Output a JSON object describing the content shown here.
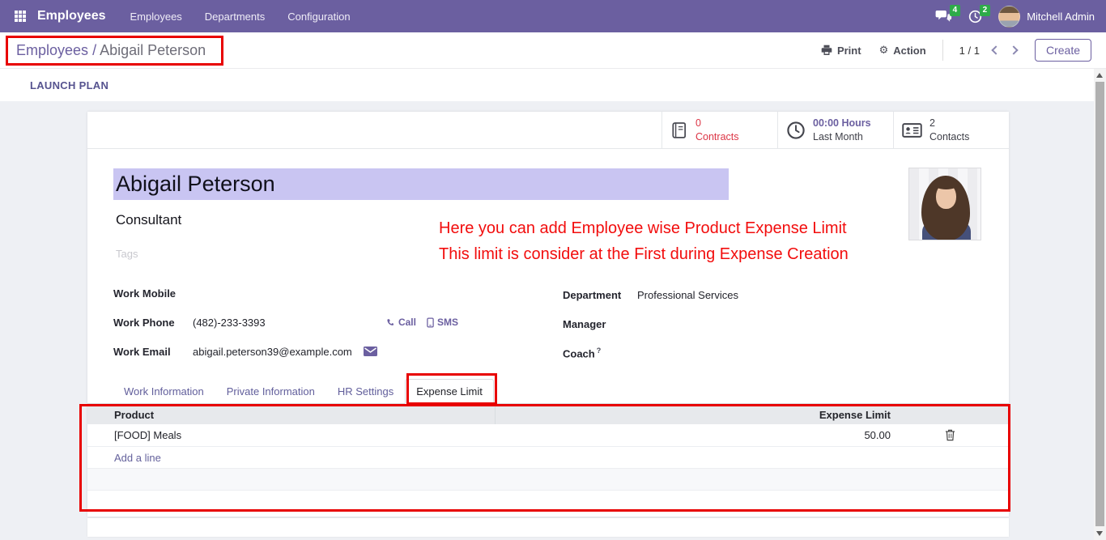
{
  "navbar": {
    "app_name": "Employees",
    "menus": [
      {
        "label": "Employees"
      },
      {
        "label": "Departments"
      },
      {
        "label": "Configuration"
      }
    ],
    "messages_badge": "4",
    "activities_badge": "2",
    "user_name": "Mitchell Admin"
  },
  "control_panel": {
    "breadcrumb": {
      "parent": "Employees",
      "separator": "/",
      "current": "Abigail Peterson"
    },
    "print_label": "Print",
    "action_label": "Action",
    "gear_glyph": "⚙",
    "pager_value": "1 / 1",
    "create_label": "Create"
  },
  "launch_plan_label": "LAUNCH PLAN",
  "stat_buttons": [
    {
      "value": "0",
      "label": "Contracts"
    },
    {
      "value": "00:00 Hours",
      "label": "Last Month"
    },
    {
      "value": "2",
      "label": "Contacts"
    }
  ],
  "employee": {
    "name": "Abigail Peterson",
    "job_title": "Consultant",
    "tags_placeholder": "Tags",
    "work_mobile_label": "Work Mobile",
    "work_phone_label": "Work Phone",
    "work_phone": "(482)-233-3393",
    "call_label": "Call",
    "sms_label": "SMS",
    "work_email_label": "Work Email",
    "work_email": "abigail.peterson39@example.com",
    "department_label": "Department",
    "department": "Professional Services",
    "manager_label": "Manager",
    "coach_label": "Coach",
    "coach_help": "?"
  },
  "annotation": {
    "line1": "Here you can add Employee wise Product Expense Limit",
    "line2": "This limit is consider at the First during Expense Creation"
  },
  "tabs": [
    {
      "label": "Work Information"
    },
    {
      "label": "Private Information"
    },
    {
      "label": "HR Settings"
    },
    {
      "label": "Expense Limit"
    }
  ],
  "expense_table": {
    "product_header": "Product",
    "limit_header": "Expense Limit",
    "rows": [
      {
        "product": "[FOOD] Meals",
        "limit": "50.00"
      }
    ],
    "add_line_label": "Add a line"
  },
  "colors": {
    "navbar_bg": "#6b5fa0",
    "accent_purple": "#65629c",
    "annotation_red": "#f20d0d",
    "badge_green": "#2eab49",
    "name_highlight": "#c9c5f2",
    "stat_danger_red": "#dc3545"
  }
}
